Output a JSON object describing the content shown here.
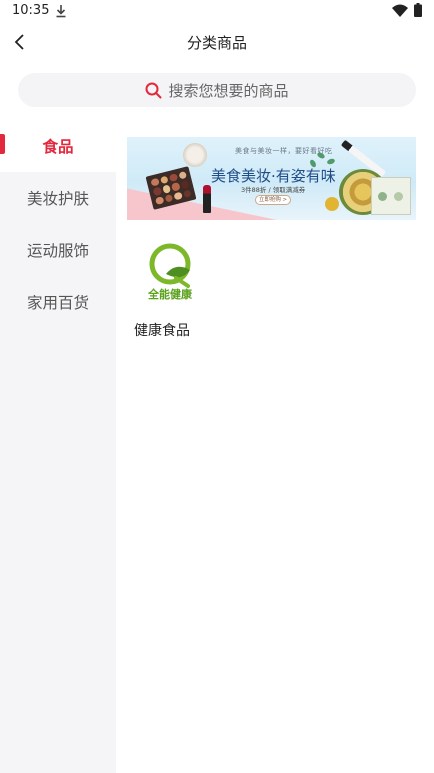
{
  "status_bar": {
    "time": "10:35",
    "icons": [
      "download-icon",
      "wifi-icon",
      "battery-icon"
    ]
  },
  "header": {
    "title": "分类商品",
    "back_icon": "chevron-left-icon"
  },
  "search": {
    "placeholder": "搜索您想要的商品",
    "icon": "search-icon",
    "icon_color": "#e4283c"
  },
  "sidebar": {
    "items": [
      {
        "label": "食品",
        "active": true
      },
      {
        "label": "美妆护肤",
        "active": false
      },
      {
        "label": "运动服饰",
        "active": false
      },
      {
        "label": "家用百货",
        "active": false
      }
    ]
  },
  "main": {
    "banner": {
      "top_text": "美食与美妆一样，要好看好吃",
      "headline": "美食美妆·有姿有味",
      "subline": "3件88折 / 领取满减券",
      "cta": "立即抢购 >"
    },
    "categories": [
      {
        "label": "健康食品",
        "logo_text": "全能健康"
      }
    ]
  },
  "colors": {
    "accent": "#e4283c",
    "sidebar_bg": "#f5f5f7",
    "search_bg": "#f4f4f6",
    "logo_green": "#7cb829"
  }
}
